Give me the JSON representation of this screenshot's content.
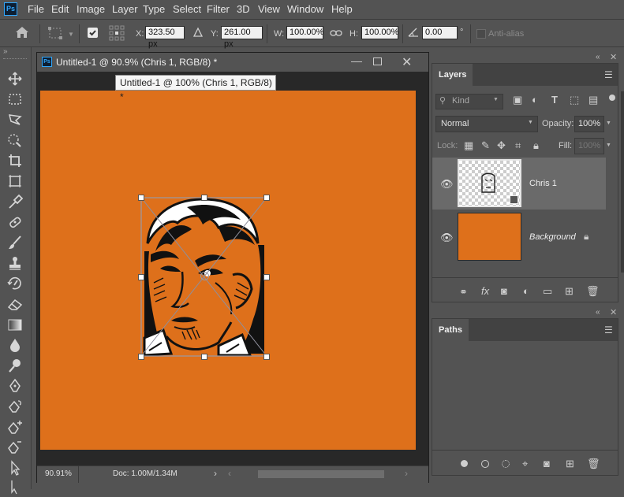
{
  "app": {
    "logo": "Ps"
  },
  "menu": [
    "File",
    "Edit",
    "Image",
    "Layer",
    "Type",
    "Select",
    "Filter",
    "3D",
    "View",
    "Window",
    "Help"
  ],
  "options": {
    "x_label": "X:",
    "x_value": "323.50 px",
    "y_label": "Y:",
    "y_value": "261.00 px",
    "w_label": "W:",
    "w_value": "100.00%",
    "h_label": "H:",
    "h_value": "100.00%",
    "angle_value": "0.00",
    "angle_unit": "°",
    "antialias_label": "Anti-alias"
  },
  "document": {
    "title": "Untitled-1 @ 90.9% (Chris 1, RGB/8) *",
    "tooltip": "Untitled-1 @ 100% (Chris 1, RGB/8) *",
    "zoom": "90.91%",
    "doc_info": "Doc: 1.00M/1.34M",
    "canvas_color": "#de701b"
  },
  "layers_panel": {
    "tab": "Layers",
    "kind_label": "Kind",
    "blend_mode": "Normal",
    "opacity_label": "Opacity:",
    "opacity_value": "100%",
    "lock_label": "Lock:",
    "fill_label": "Fill:",
    "fill_value": "100%",
    "layers": [
      {
        "name": "Chris 1",
        "italic": false,
        "selected": true
      },
      {
        "name": "Background",
        "italic": true,
        "selected": false
      }
    ]
  },
  "paths_panel": {
    "tab": "Paths"
  }
}
